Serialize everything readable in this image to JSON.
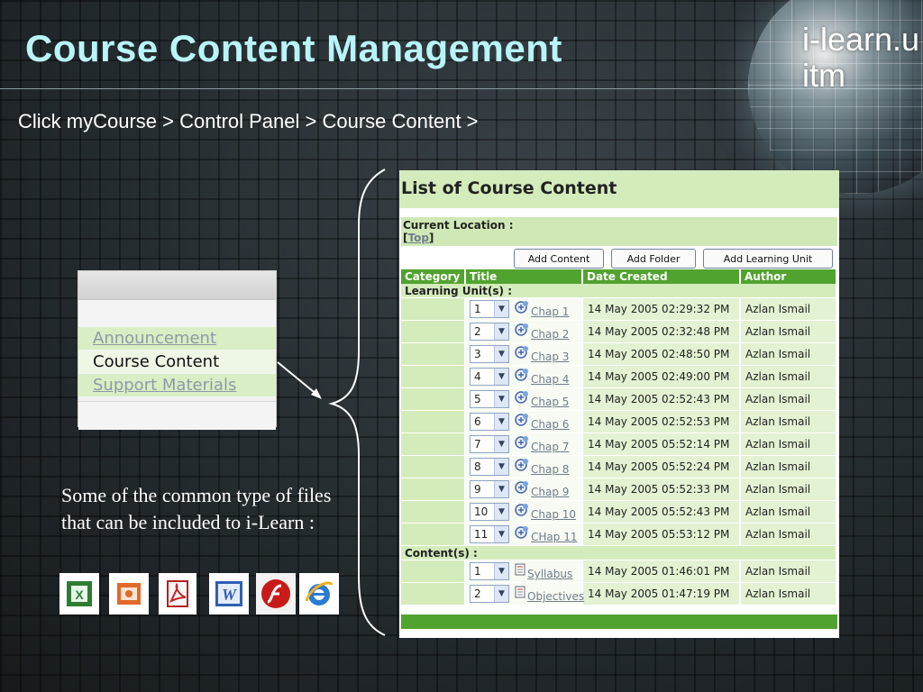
{
  "slide": {
    "title": "Course Content Management",
    "instruction": "Click myCourse > Control Panel > Course Content >",
    "logo_text": "i-learn.uitm",
    "file_caption": "Some of the common type of files that can be included to i-Learn :",
    "accent_color": "#b8f4f8"
  },
  "menu": {
    "items": [
      {
        "label": "Announcement"
      },
      {
        "label": "Course Content"
      },
      {
        "label": "Support Materials"
      }
    ]
  },
  "file_types": [
    "excel-icon",
    "powerpoint-icon",
    "pdf-icon",
    "word-icon",
    "flash-icon",
    "internet-explorer-icon"
  ],
  "panel": {
    "title": "List of Course Content",
    "current_location_label": "Current Location :",
    "top_link": "Top",
    "buttons": {
      "add_content": "Add Content",
      "add_folder": "Add Folder",
      "add_learning_unit": "Add Learning Unit"
    },
    "columns": [
      "Category",
      "Title",
      "Date Created",
      "Author"
    ],
    "learning_units_label": "Learning Unit(s) :",
    "learning_units": [
      {
        "order": "1",
        "title": "Chap 1",
        "date": "14 May 2005 02:29:32 PM",
        "author": "Azlan Ismail"
      },
      {
        "order": "2",
        "title": "Chap 2",
        "date": "14 May 2005 02:32:48 PM",
        "author": "Azlan Ismail"
      },
      {
        "order": "3",
        "title": "Chap 3",
        "date": "14 May 2005 02:48:50 PM",
        "author": "Azlan Ismail"
      },
      {
        "order": "4",
        "title": "Chap 4",
        "date": "14 May 2005 02:49:00 PM",
        "author": "Azlan Ismail"
      },
      {
        "order": "5",
        "title": "Chap 5",
        "date": "14 May 2005 02:52:43 PM",
        "author": "Azlan Ismail"
      },
      {
        "order": "6",
        "title": "Chap 6",
        "date": "14 May 2005 02:52:53 PM",
        "author": "Azlan Ismail"
      },
      {
        "order": "7",
        "title": "Chap 7",
        "date": "14 May 2005 05:52:14 PM",
        "author": "Azlan Ismail"
      },
      {
        "order": "8",
        "title": "Chap 8",
        "date": "14 May 2005 05:52:24 PM",
        "author": "Azlan Ismail"
      },
      {
        "order": "9",
        "title": "Chap 9",
        "date": "14 May 2005 05:52:33 PM",
        "author": "Azlan Ismail"
      },
      {
        "order": "10",
        "title": "Chap 10",
        "date": "14 May 2005 05:52:43 PM",
        "author": "Azlan Ismail"
      },
      {
        "order": "11",
        "title": "CHap 11",
        "date": "14 May 2005 05:53:12 PM",
        "author": "Azlan Ismail"
      }
    ],
    "contents_label": "Content(s) :",
    "contents": [
      {
        "order": "1",
        "title": "Syllabus",
        "date": "14 May 2005 01:46:01 PM",
        "author": "Azlan Ismail"
      },
      {
        "order": "2",
        "title": "Objectives",
        "date": "14 May 2005 01:47:19 PM",
        "author": "Azlan Ismail"
      }
    ]
  }
}
